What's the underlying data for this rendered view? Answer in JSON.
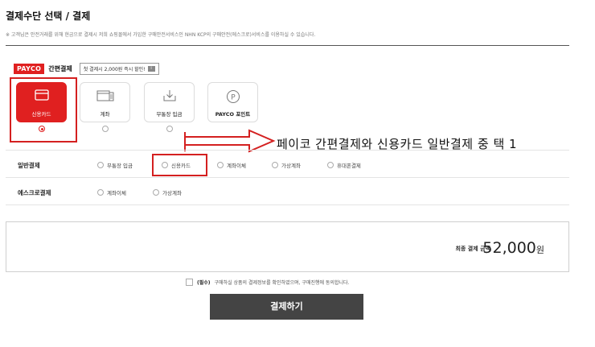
{
  "header": {
    "title": "결제수단 선택 / 결제",
    "notice": "※ 고객님은 안전거래를 위해 현금으로 결제시 저희 쇼핑몰에서 가입한 구매안전서비스인 NHN KCP의 구매안전(에스크로)서비스를 이용하실 수 있습니다."
  },
  "payco": {
    "logo": "PAYCO",
    "label": "간편결제",
    "promo": "첫 결제시 2,000원 즉시 할인!",
    "promo_icon_text": "i"
  },
  "tiles": [
    {
      "label": "신용카드",
      "icon": "credit-card-icon",
      "selected": true
    },
    {
      "label": "계좌",
      "icon": "bank-account-icon",
      "selected": false
    },
    {
      "label": "무통장 입금",
      "icon": "deposit-icon",
      "selected": false
    },
    {
      "label": "PAYCO 포인트",
      "icon": "payco-point-icon",
      "icon_text": "P",
      "selected": false
    }
  ],
  "annotation": "페이코 간편결제와 신용카드 일반결제 중 택 1",
  "general_payment": {
    "label": "일반결제",
    "options": [
      "무통장 입금",
      "신용카드",
      "계좌이체",
      "가상계좌",
      "휴대폰결제"
    ]
  },
  "escrow_payment": {
    "label": "에스크로결제",
    "options": [
      "계좌이체",
      "가상계좌"
    ]
  },
  "total": {
    "label": "최종 결제 금액",
    "amount": "52,000",
    "unit": "원"
  },
  "agreement": {
    "required": "(필수)",
    "text": "구매하실 상품의 결제정보를 확인하였으며, 구매진행에 동의합니다."
  },
  "pay_button": "결제하기",
  "colors": {
    "accent": "#e02020",
    "highlight": "#d42020",
    "button": "#444444"
  }
}
